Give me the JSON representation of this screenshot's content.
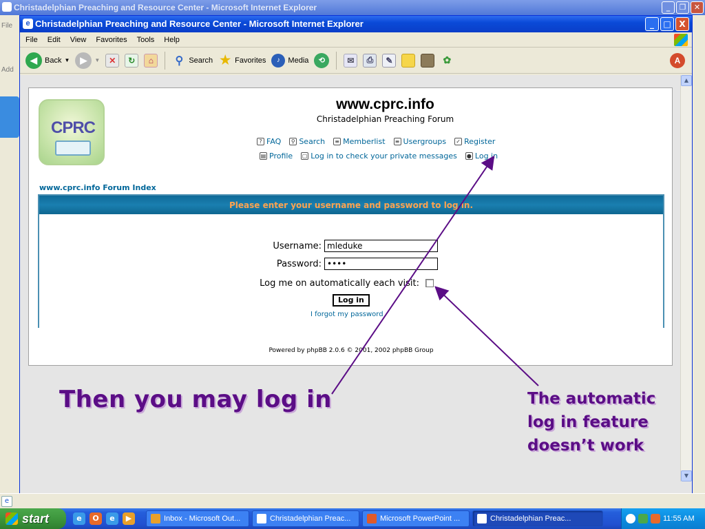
{
  "background_window": {
    "title": "Christadelphian Preaching and Resource Center - Microsoft Internet Explorer",
    "left_fragments": [
      "File",
      "Add"
    ]
  },
  "window": {
    "title": "Christadelphian Preaching and Resource Center - Microsoft Internet Explorer",
    "controls": {
      "minimize": "_",
      "maximize": "□",
      "close": "X"
    }
  },
  "menu": [
    "File",
    "Edit",
    "View",
    "Favorites",
    "Tools",
    "Help"
  ],
  "toolbar": {
    "back": "Back",
    "search": "Search",
    "favorites": "Favorites",
    "media": "Media"
  },
  "forum": {
    "logo_text": "CPRC",
    "site_name": "www.cprc.info",
    "site_desc": "Christadelphian Preaching Forum",
    "nav_top": [
      "FAQ",
      "Search",
      "Memberlist",
      "Usergroups",
      "Register"
    ],
    "nav_bottom": [
      "Profile",
      "Log in to check your private messages",
      "Log in"
    ],
    "index_link": "www.cprc.info Forum Index",
    "login_header": "Please enter your username and password to log in.",
    "username_label": "Username:",
    "username_value": "mleduke",
    "password_label": "Password:",
    "password_value": "••••",
    "autologin_label": "Log me on automatically each visit:",
    "login_button": "Log in",
    "forgot_link": "I forgot my password",
    "powered_by": "Powered by phpBB 2.0.6 © 2001, 2002 phpBB Group"
  },
  "annotations": {
    "left": "Then you may log in",
    "right": "The automatic log in feature doesn’t work",
    "color": "#5b0d86"
  },
  "taskbar": {
    "start": "start",
    "tasks": [
      {
        "label": "Inbox - Microsoft Out...",
        "active": false
      },
      {
        "label": "Christadelphian Preac...",
        "active": false
      },
      {
        "label": "Microsoft PowerPoint ...",
        "active": false
      },
      {
        "label": "Christadelphian Preac...",
        "active": true
      }
    ],
    "clock": "11:55 AM"
  }
}
